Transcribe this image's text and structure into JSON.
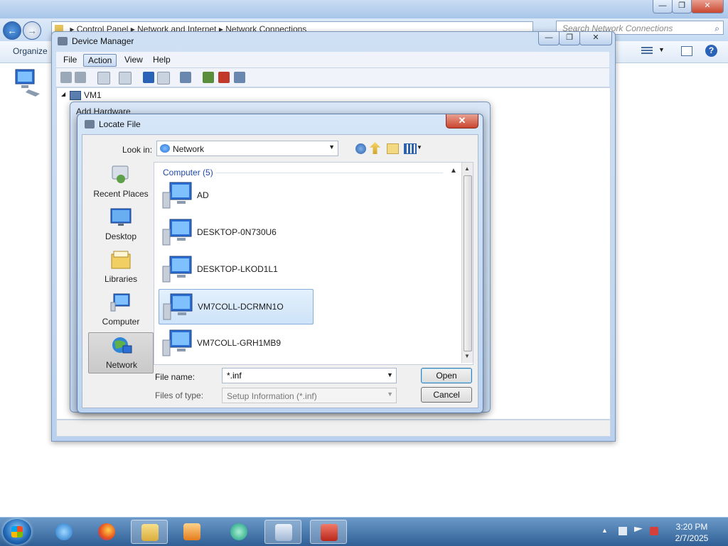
{
  "explorer": {
    "breadcrumb": [
      "Control Panel",
      "Network and Internet",
      "Network Connections"
    ],
    "search_placeholder": "Search Network Connections",
    "organize_label": "Organize"
  },
  "device_manager": {
    "title": "Device Manager",
    "menu": [
      "File",
      "Action",
      "View",
      "Help"
    ],
    "active_menu": "Action",
    "tree_root": "VM1"
  },
  "add_hardware": {
    "title": "Add Hardware"
  },
  "locate_file": {
    "title": "Locate File",
    "close_glyph": "✕",
    "look_in_label": "Look in:",
    "look_in_value": "Network",
    "places": [
      {
        "label": "Recent Places"
      },
      {
        "label": "Desktop"
      },
      {
        "label": "Libraries"
      },
      {
        "label": "Computer"
      },
      {
        "label": "Network"
      }
    ],
    "selected_place": "Network",
    "group_header": "Computer (5)",
    "computers": [
      {
        "name": "AD"
      },
      {
        "name": "DESKTOP-0N730U6"
      },
      {
        "name": "DESKTOP-LKOD1L1"
      },
      {
        "name": "VM7COLL-DCRMN1O"
      },
      {
        "name": "VM7COLL-GRH1MB9"
      }
    ],
    "selected_computer": "VM7COLL-DCRMN1O",
    "file_name_label": "File name:",
    "file_name_value": "*.inf",
    "files_of_type_label": "Files of type:",
    "files_of_type_value": "Setup Information (*.inf)",
    "open_label": "Open",
    "cancel_label": "Cancel"
  },
  "taskbar": {
    "time": "3:20 PM",
    "date": "2/7/2025",
    "pinned": [
      "internet-explorer",
      "firefox",
      "file-explorer",
      "media-player",
      "teamviewer",
      "device-manager",
      "toolbox"
    ]
  },
  "colors": {
    "titlebar": "#b9d1ee",
    "selection": "#cde3f8",
    "close_red": "#c9462e",
    "link_blue": "#1e4aa8",
    "taskbar": "#2f5f95"
  }
}
